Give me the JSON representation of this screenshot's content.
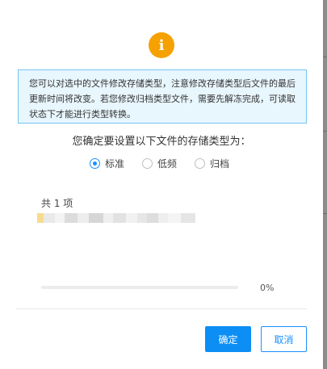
{
  "dialog": {
    "notice": "您可以对选中的文件修改存储类型，注意修改存储类型后文件的最后更新时间将改变。若您修改归档类型文件，需要先解冻完成，可读取状态下才能进行类型转换。",
    "question": "您确定要设置以下文件的存储类型为：",
    "storage_options": [
      {
        "label": "标准",
        "selected": true
      },
      {
        "label": "低频",
        "selected": false
      },
      {
        "label": "归档",
        "selected": false
      }
    ],
    "item_count": "共 1 项",
    "progress": {
      "label": "0%",
      "value": 0
    },
    "buttons": {
      "ok": "确定",
      "cancel": "取消"
    },
    "icons": {
      "info": "info-icon"
    }
  },
  "colors": {
    "accent": "#1890ff",
    "primary_button": "#0c8ef5",
    "info_icon": "#f5a100",
    "notice_bg": "#e8f6fd",
    "notice_border": "#74c7f0"
  }
}
